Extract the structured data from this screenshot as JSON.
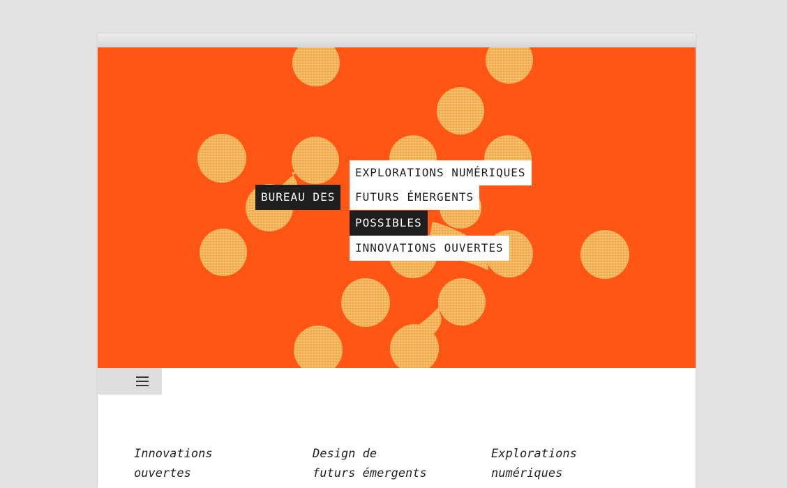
{
  "colors": {
    "page_bg": "#e3e3e3",
    "hero_bg": "#ff5616",
    "blob": "#f4b45a",
    "label_dark": "#1e1e1e",
    "label_light": "#ffffff"
  },
  "hero": {
    "left_label": "BUREAU DES",
    "words": [
      "EXPLORATIONS NUMÉRIQUES",
      "FUTURS ÉMERGENTS",
      "POSSIBLES",
      "INNOVATIONS OUVERTES"
    ]
  },
  "menu": {
    "icon": "hamburger-menu-icon"
  },
  "columns": [
    "Innovations\nouvertes",
    "Design de\nfuturs émergents",
    "Explorations\nnumériques"
  ]
}
